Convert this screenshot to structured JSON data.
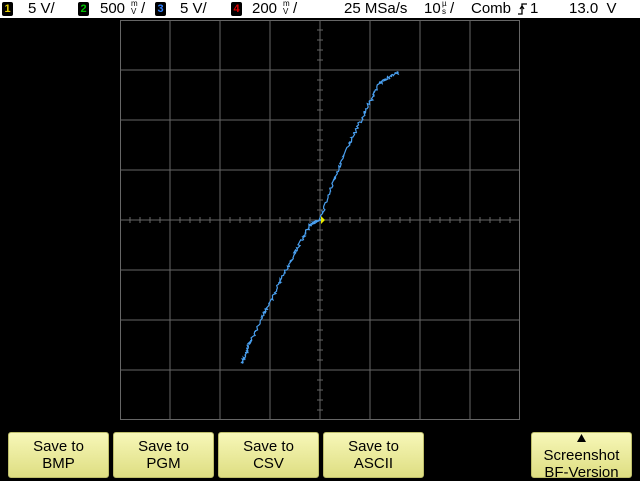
{
  "status_bar": {
    "channels": [
      {
        "number": "1",
        "color": "#e8d000",
        "scale": "5 V/"
      },
      {
        "number": "2",
        "color": "#00a000",
        "scale": "500",
        "unit_top": "m",
        "unit_bottom": "V"
      },
      {
        "number": "3",
        "color": "#3080ff",
        "scale": "5 V/"
      },
      {
        "number": "4",
        "color": "#e00000",
        "scale": "200",
        "unit_top": "m",
        "unit_bottom": "V"
      }
    ],
    "sample_rate": "25 MSa/s",
    "timebase_value": "10",
    "timebase_unit_top": "µ",
    "timebase_unit_bottom": "s",
    "trigger_mode": "Comb",
    "trigger_slope_icon": "rising-edge-icon",
    "trigger_source": "1",
    "trigger_level": "13.0  V"
  },
  "display": {
    "mode": "XY",
    "trace_color": "#4aa0f0",
    "grid_color": "#666666",
    "divisions": 8,
    "cursor_color": "#e8e800",
    "chart_data": {
      "type": "scatter",
      "x_divisions": [
        -1.55,
        -1.4,
        -1.1,
        -0.8,
        -0.5,
        -0.2,
        0.0,
        0.3,
        0.6,
        0.9,
        1.2,
        1.55
      ],
      "y_divisions": [
        -2.85,
        -2.45,
        -1.85,
        -1.25,
        -0.65,
        -0.1,
        0.0,
        0.85,
        1.55,
        2.15,
        2.75,
        2.95
      ],
      "xlim": [
        -4,
        4
      ],
      "ylim": [
        -4,
        4
      ]
    }
  },
  "softkeys": [
    {
      "line1": "Save to",
      "line2": "BMP"
    },
    {
      "line1": "Save to",
      "line2": "PGM"
    },
    {
      "line1": "Save to",
      "line2": "CSV"
    },
    {
      "line1": "Save to",
      "line2": "ASCII"
    },
    {
      "line1": "Screenshot",
      "line2": "BF-Version",
      "icon": "up-triangle-icon"
    }
  ]
}
